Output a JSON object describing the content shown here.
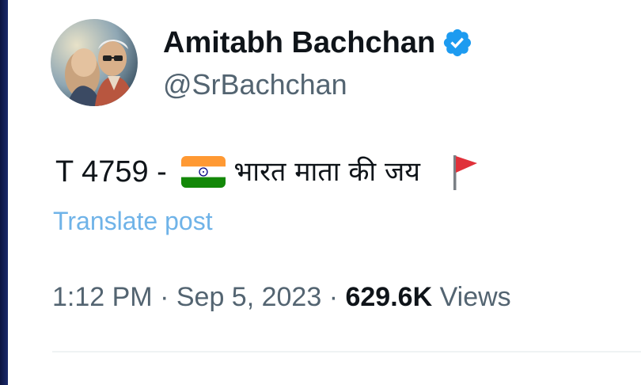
{
  "post": {
    "author_name": "Amitabh Bachchan",
    "handle": "@SrBachchan",
    "verified_icon": "verified-badge-icon",
    "text_prefix": "T 4759 - ",
    "text_hindi": "भारत माता की जय",
    "emoji_1": "india-flag-icon",
    "emoji_2": "red-flag-icon",
    "translate_label": "Translate post",
    "time": "1:12 PM",
    "separator": "·",
    "date": "Sep 5, 2023",
    "views_count": "629.6K",
    "views_label": "Views"
  },
  "colors": {
    "verified_blue": "#1d9bf0",
    "link_blue": "#6fb3e8",
    "text_primary": "#0f1419",
    "text_secondary": "#536471"
  }
}
